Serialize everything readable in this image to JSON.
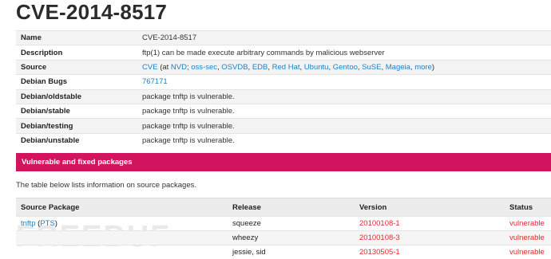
{
  "title": "CVE-2014-8517",
  "info": {
    "name_label": "Name",
    "name_value": "CVE-2014-8517",
    "description_label": "Description",
    "description_value": "ftp(1) can be made execute arbitrary commands by malicious webserver",
    "source_label": "Source",
    "source": {
      "cve": "CVE",
      "at": "(at",
      "nvd": "NVD",
      "sep": ";",
      "oss_sec": "oss-sec",
      "osvdb": "OSVDB",
      "edb": "EDB",
      "redhat": "Red Hat",
      "ubuntu": "Ubuntu",
      "gentoo": "Gentoo",
      "suse": "SuSE",
      "mageia": "Mageia",
      "more": "more",
      "close": ")",
      "comma": ","
    },
    "bugs_label": "Debian Bugs",
    "bugs_value": "767171",
    "oldstable_label": "Debian/oldstable",
    "oldstable_value": "package tnftp is vulnerable.",
    "stable_label": "Debian/stable",
    "stable_value": "package tnftp is vulnerable.",
    "testing_label": "Debian/testing",
    "testing_value": "package tnftp is vulnerable.",
    "unstable_label": "Debian/unstable",
    "unstable_value": "package tnftp is vulnerable."
  },
  "section_title": "Vulnerable and fixed packages",
  "section_note": "The table below lists information on source packages.",
  "packages": {
    "headers": [
      "Source Package",
      "Release",
      "Version",
      "Status"
    ],
    "package_name": "tnftp",
    "pts_link": "PTS",
    "rows": [
      {
        "release": "squeeze",
        "version": "20100108-1",
        "status": "vulnerable"
      },
      {
        "release": "wheezy",
        "version": "20100108-3",
        "status": "vulnerable"
      },
      {
        "release": "jessie, sid",
        "version": "20130505-1",
        "status": "vulnerable"
      }
    ]
  },
  "watermark": "FREEBUF",
  "colors": {
    "banner": "#d2135e",
    "link": "#1a82c8",
    "vulnerable": "#e0282d"
  }
}
